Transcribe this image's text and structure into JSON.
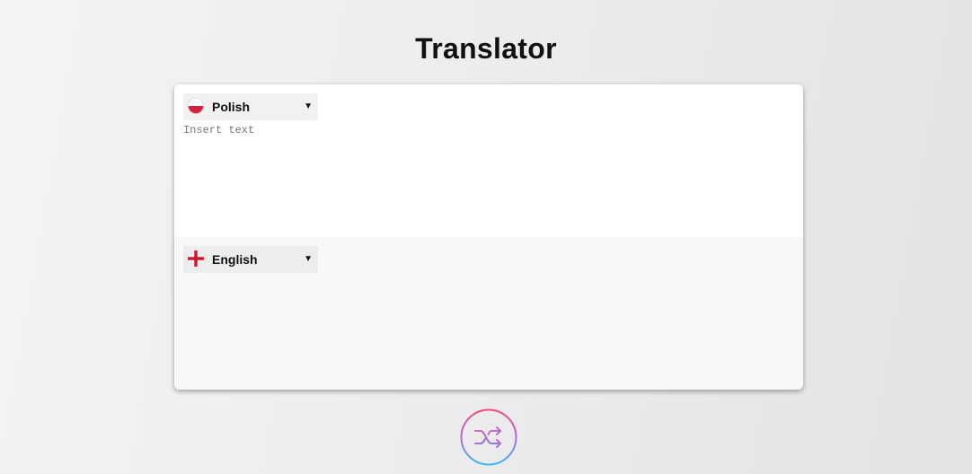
{
  "page": {
    "title": "Translator"
  },
  "source": {
    "language": "Polish",
    "flag_icon": "poland-flag-icon",
    "caret_icon": "▼",
    "placeholder": "Insert text",
    "value": ""
  },
  "target": {
    "language": "English",
    "flag_icon": "england-flag-icon",
    "caret_icon": "▼",
    "value": ""
  },
  "swap": {
    "icon": "shuffle-icon",
    "gradient_colors": [
      "#f04a78",
      "#b06ae0",
      "#3ab8ea"
    ]
  }
}
